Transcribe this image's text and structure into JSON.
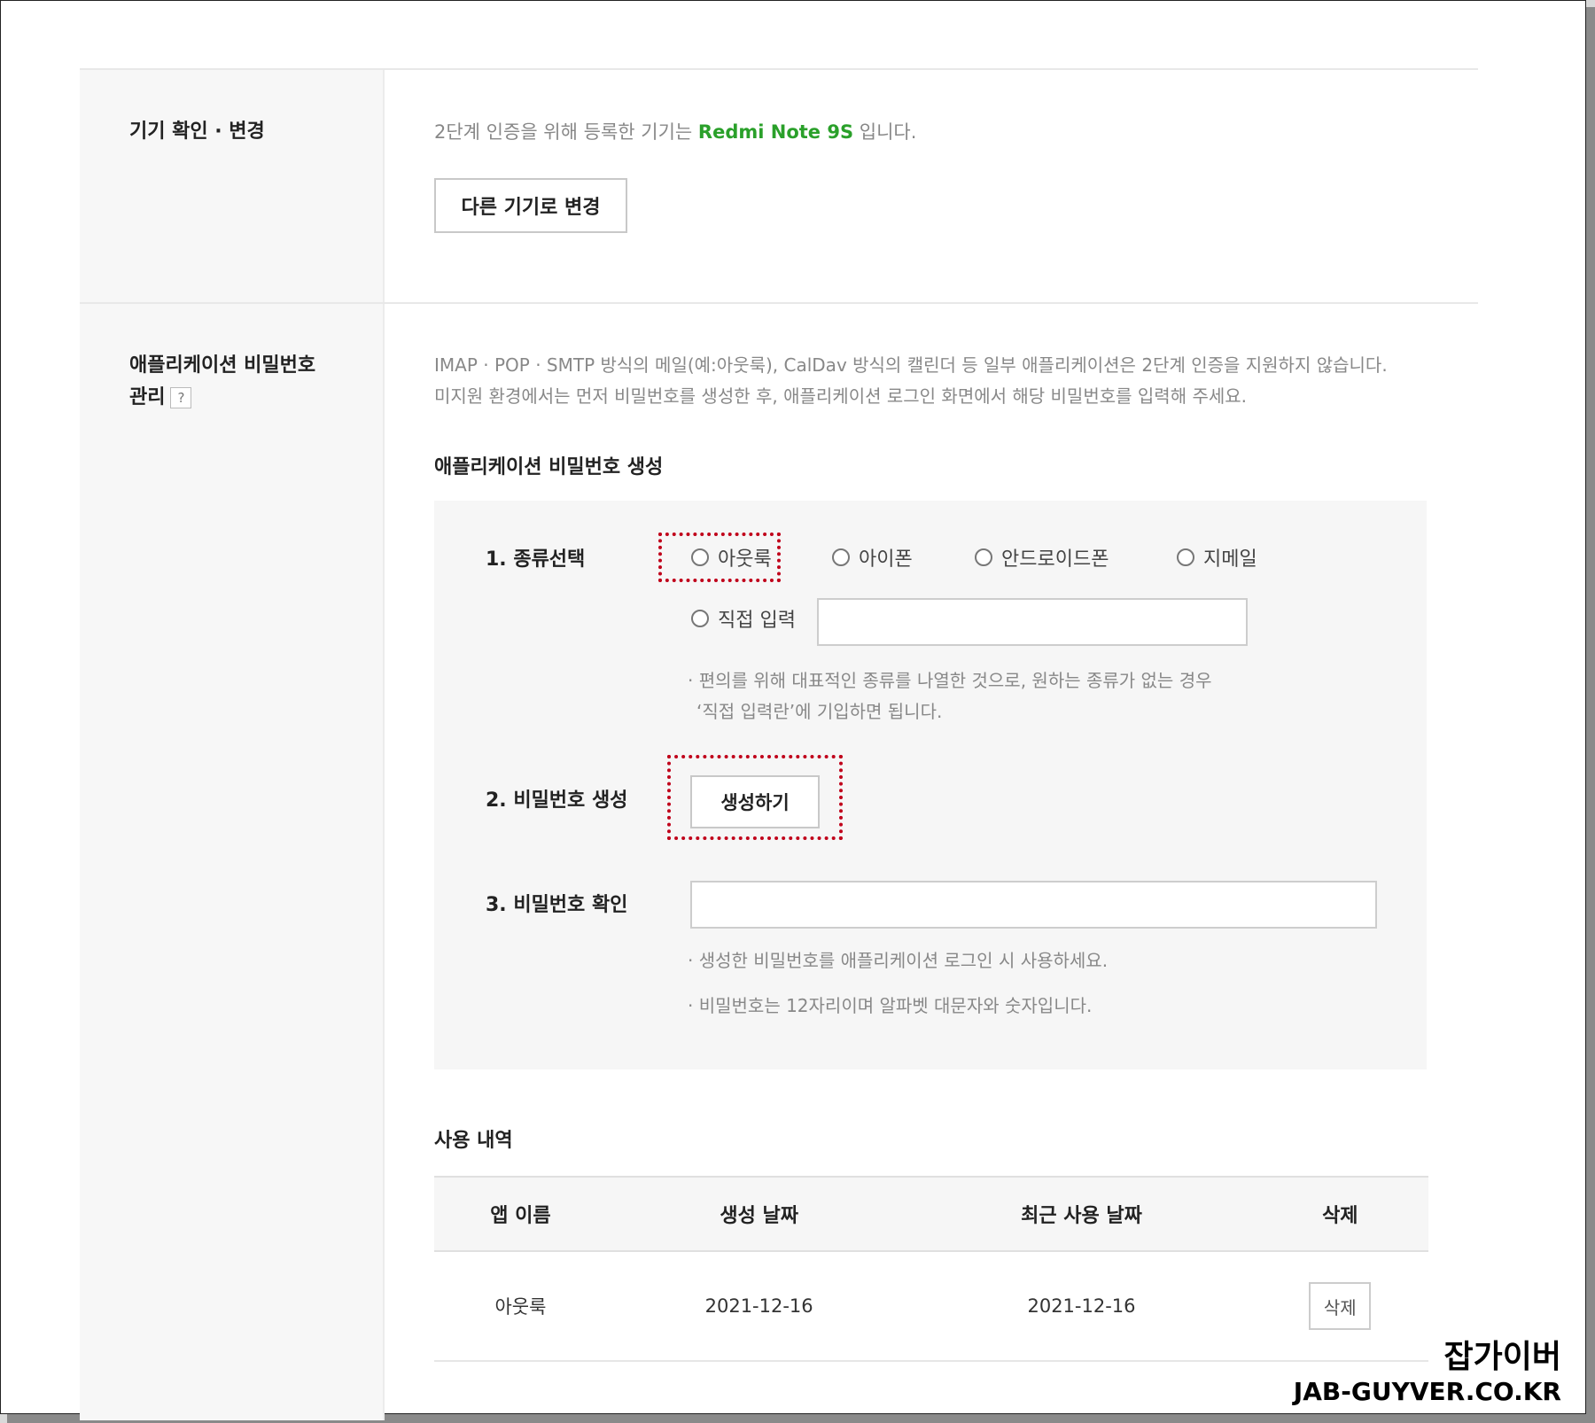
{
  "device_section": {
    "label": "기기 확인 · 변경",
    "text_before": "2단계 인증을 위해 등록한 기기는 ",
    "device_name": "Redmi Note 9S",
    "text_after": " 입니다.",
    "change_button": "다른 기기로 변경"
  },
  "app_password_section": {
    "label_line1": "애플리케이션 비밀번호",
    "label_line2": "관리",
    "help_icon": "?",
    "description_line1": "IMAP · POP · SMTP 방식의 메일(예:아웃룩), CalDav 방식의 캘린더 등 일부 애플리케이션은 2단계 인증을 지원하지 않습니다.",
    "description_line2": "미지원 환경에서는 먼저 비밀번호를 생성한 후, 애플리케이션 로그인 화면에서 해당 비밀번호를 입력해 주세요.",
    "generate_title": "애플리케이션 비밀번호 생성",
    "step1_label": "1. 종류선택",
    "type_options": [
      "아웃룩",
      "아이폰",
      "안드로이드폰",
      "지메일"
    ],
    "direct_input_label": "직접 입력",
    "direct_input_value": "",
    "type_note_line1": "· 편의를 위해 대표적인 종류를 나열한 것으로, 원하는 종류가 없는 경우",
    "type_note_line2": "‘직접 입력란’에 기입하면 됩니다.",
    "step2_label": "2. 비밀번호 생성",
    "generate_button": "생성하기",
    "step3_label": "3. 비밀번호 확인",
    "password_value": "",
    "confirm_note1": "· 생성한 비밀번호를 애플리케이션 로그인 시 사용하세요.",
    "confirm_note2": "· 비밀번호는 12자리이며 알파벳 대문자와 숫자입니다.",
    "history_title": "사용 내역",
    "history_headers": [
      "앱 이름",
      "생성 날짜",
      "최근 사용 날짜",
      "삭제"
    ],
    "history_rows": [
      {
        "app": "아웃룩",
        "created": "2021-12-16",
        "last_used": "2021-12-16",
        "delete_label": "삭제"
      }
    ]
  },
  "watermark": {
    "korean": "잡가이버",
    "english": "JAB-GUYVER.CO.KR"
  },
  "colors": {
    "device_name": "#2aa02a",
    "highlight_border": "#c0001a"
  }
}
